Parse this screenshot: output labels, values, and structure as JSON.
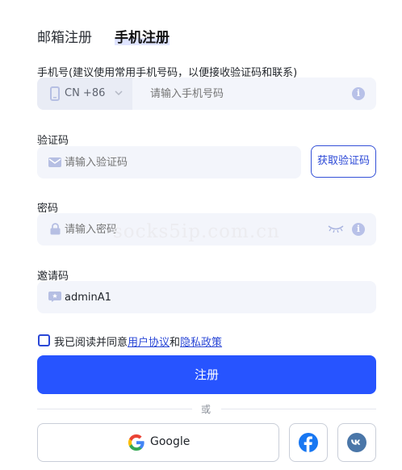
{
  "tabs": {
    "email": "邮箱注册",
    "phone": "手机注册"
  },
  "phone": {
    "label": "手机号(建议使用常用手机号码，以便接收验证码和联系)",
    "country_code": "CN +86",
    "placeholder": "请输入手机号码",
    "info_icon": "info-icon"
  },
  "code": {
    "label": "验证码",
    "placeholder": "请输入验证码",
    "button": "获取验证码",
    "icon": "mail-icon"
  },
  "password": {
    "label": "密码",
    "placeholder": "请输入密码",
    "icon": "lock-icon"
  },
  "invite": {
    "label": "邀请码",
    "value": "adminA1",
    "icon": "invite-card-icon"
  },
  "agreement": {
    "prefix": "我已阅读并同意",
    "terms": "用户协议",
    "and": "和",
    "privacy": "隐私政策"
  },
  "submit": "注册",
  "divider": "或",
  "social": {
    "google": "Google"
  },
  "watermark": "socks5ip.com.cn",
  "colors": {
    "primary": "#2754ff",
    "accent": "#2a47d6",
    "field_bg": "#f3f5fb"
  }
}
